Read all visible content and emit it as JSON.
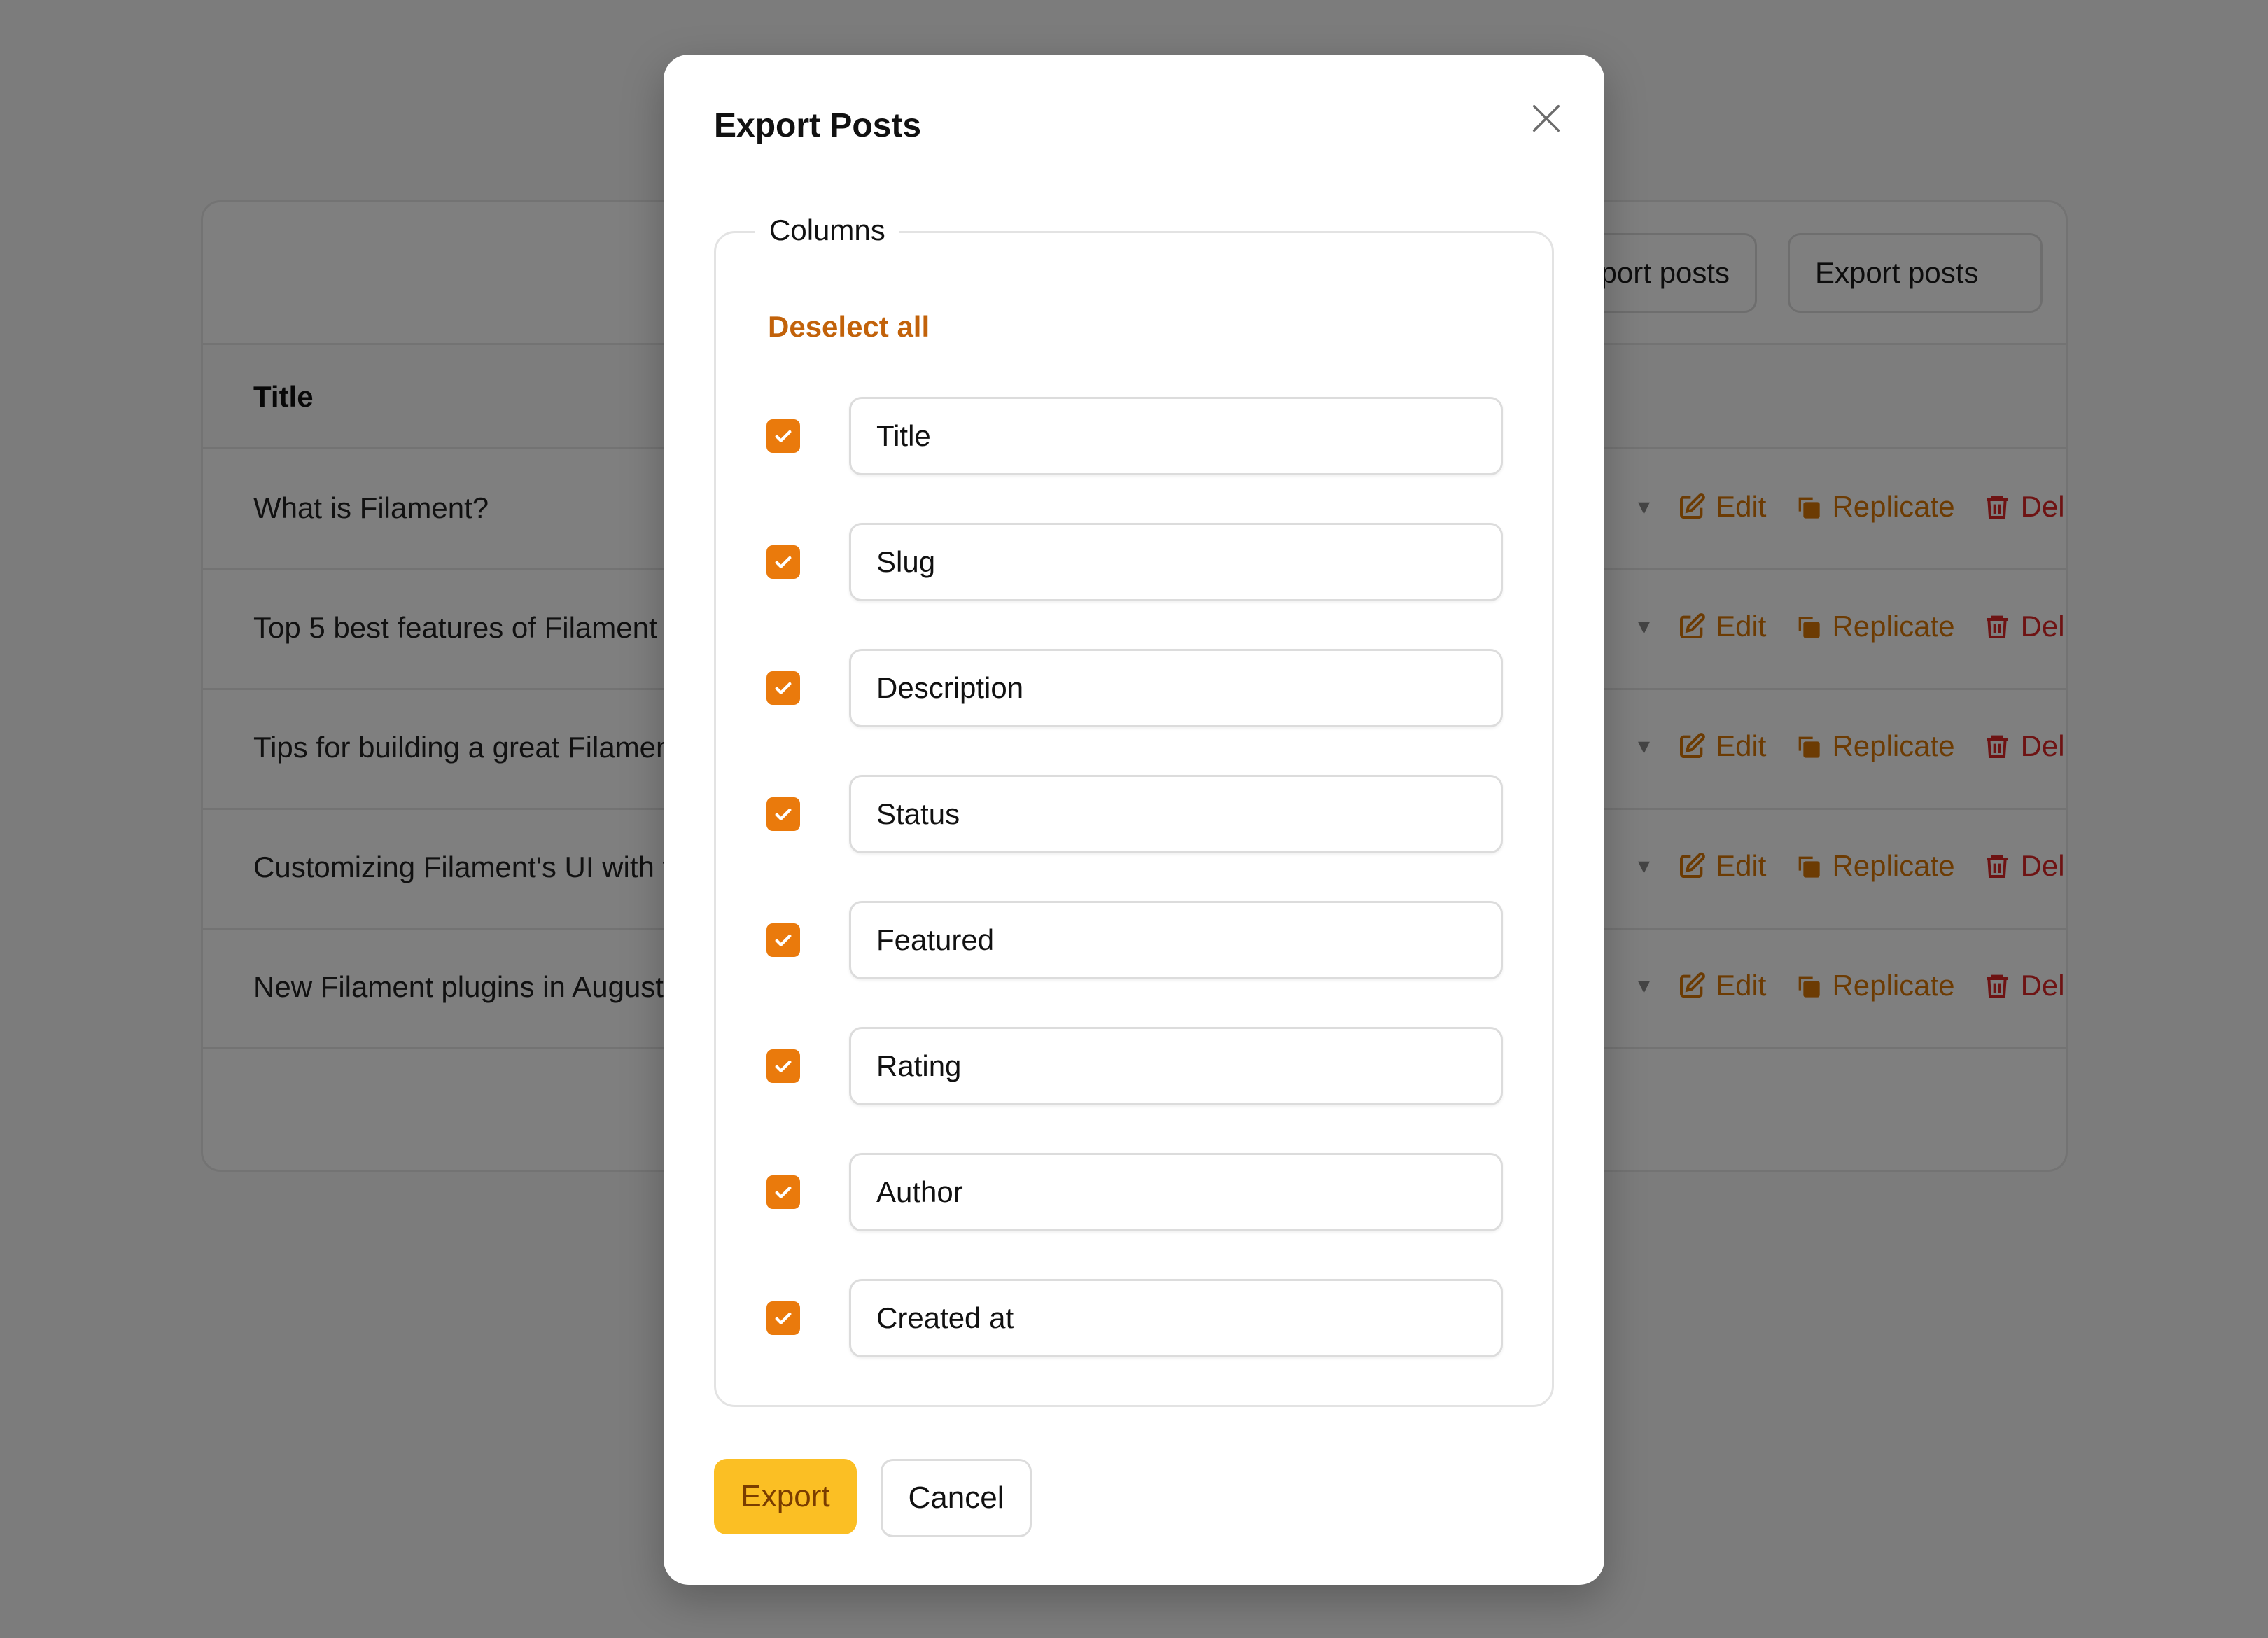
{
  "background": {
    "toolbar": {
      "import_label": "Import posts",
      "export_label": "Export posts"
    },
    "table": {
      "header_title": "Title",
      "rows": [
        {
          "title": "What is Filament?"
        },
        {
          "title": "Top 5 best features of Filament"
        },
        {
          "title": "Tips for building a great Filament plugin"
        },
        {
          "title": "Customizing Filament's UI with themes"
        },
        {
          "title": "New Filament plugins in August"
        }
      ],
      "actions": {
        "edit": "Edit",
        "replicate": "Replicate",
        "delete": "Delete"
      }
    }
  },
  "modal": {
    "title": "Export Posts",
    "fieldset_legend": "Columns",
    "deselect_all": "Deselect all",
    "columns": [
      {
        "label": "Title",
        "checked": true
      },
      {
        "label": "Slug",
        "checked": true
      },
      {
        "label": "Description",
        "checked": true
      },
      {
        "label": "Status",
        "checked": true
      },
      {
        "label": "Featured",
        "checked": true
      },
      {
        "label": "Rating",
        "checked": true
      },
      {
        "label": "Author",
        "checked": true
      },
      {
        "label": "Created at",
        "checked": true
      }
    ],
    "export_label": "Export",
    "cancel_label": "Cancel"
  },
  "colors": {
    "primary": "#ea7a0c",
    "primary_text": "#c2620a",
    "export_button": "#fbbf24",
    "danger": "#dc2626"
  }
}
